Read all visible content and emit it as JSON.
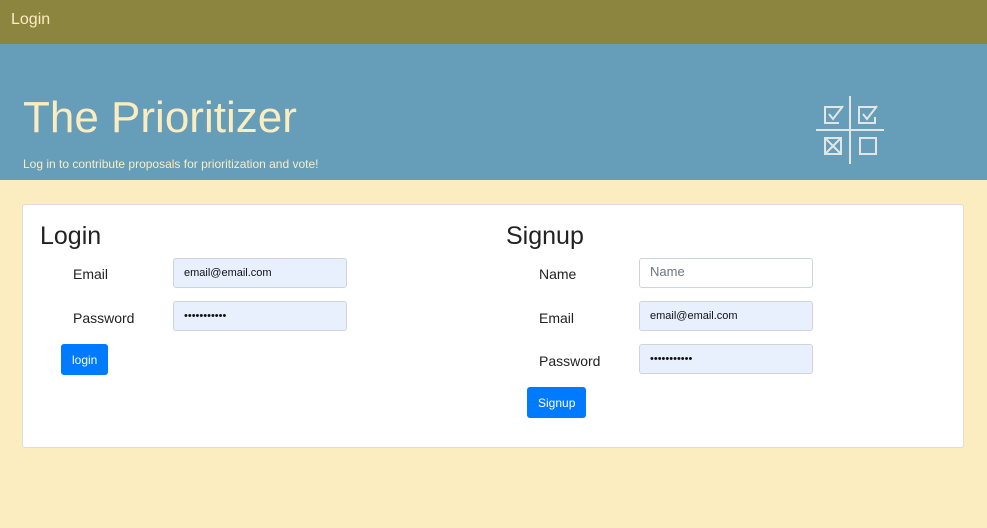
{
  "navbar": {
    "brand": "Login"
  },
  "hero": {
    "title": "The Prioritizer",
    "subtitle": "Log in to contribute proposals for prioritization and vote!",
    "logo_icon": "prioritization-matrix-icon"
  },
  "login": {
    "heading": "Login",
    "email_label": "Email",
    "email_value": "email@email.com",
    "password_label": "Password",
    "password_value": "•••••••••••",
    "button": "login"
  },
  "signup": {
    "heading": "Signup",
    "name_label": "Name",
    "name_placeholder": "Name",
    "email_label": "Email",
    "email_value": "email@email.com",
    "password_label": "Password",
    "password_value": "•••••••••••",
    "button": "Signup"
  },
  "colors": {
    "navbar": "#8c853f",
    "hero": "#669db9",
    "background": "#fbedc0",
    "button": "#007bff",
    "autofill": "#e8f0fe"
  }
}
